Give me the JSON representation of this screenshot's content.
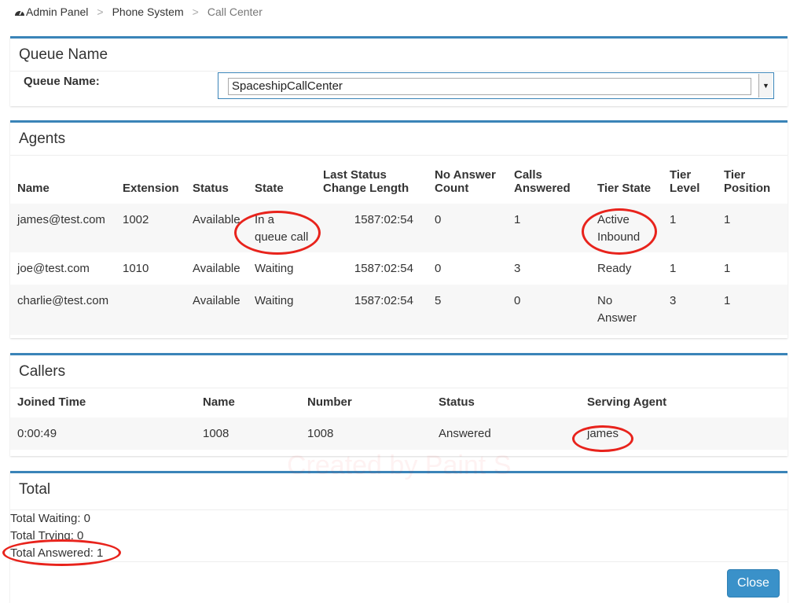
{
  "breadcrumb": {
    "items": [
      "Admin Panel",
      "Phone System",
      "Call Center"
    ]
  },
  "queue": {
    "heading": "Queue Name",
    "label": "Queue Name:",
    "selected": "SpaceshipCallCenter"
  },
  "agents": {
    "heading": "Agents",
    "columns": {
      "name": "Name",
      "extension": "Extension",
      "status": "Status",
      "state": "State",
      "last_status_1": "Last Status",
      "last_status_2": "Change Length",
      "no_answer_1": "No Answer",
      "no_answer_2": "Count",
      "calls_1": "Calls",
      "calls_2": "Answered",
      "tier_state": "Tier State",
      "tier_level_1": "Tier",
      "tier_level_2": "Level",
      "tier_position_1": "Tier",
      "tier_position_2": "Position"
    },
    "rows": [
      {
        "name": "james@test.com",
        "extension": "1002",
        "status": "Available",
        "state_1": "In a",
        "state_2": "queue call",
        "length": "1587:02:54",
        "no_answer": "0",
        "calls": "1",
        "tier_state_1": "Active",
        "tier_state_2": "Inbound",
        "tier_level": "1",
        "tier_position": "1"
      },
      {
        "name": "joe@test.com",
        "extension": "1010",
        "status": "Available",
        "state_1": "Waiting",
        "state_2": "",
        "length": "1587:02:54",
        "no_answer": "0",
        "calls": "3",
        "tier_state_1": "Ready",
        "tier_state_2": "",
        "tier_level": "1",
        "tier_position": "1"
      },
      {
        "name": "charlie@test.com",
        "extension": "",
        "status": "Available",
        "state_1": "Waiting",
        "state_2": "",
        "length": "1587:02:54",
        "no_answer": "5",
        "calls": "0",
        "tier_state_1": "No",
        "tier_state_2": "Answer",
        "tier_level": "3",
        "tier_position": "1"
      }
    ]
  },
  "callers": {
    "heading": "Callers",
    "columns": {
      "joined": "Joined Time",
      "name": "Name",
      "number": "Number",
      "status": "Status",
      "agent": "Serving Agent"
    },
    "rows": [
      {
        "joined": "0:00:49",
        "name": "1008",
        "number": "1008",
        "status": "Answered",
        "agent": "james"
      }
    ]
  },
  "total": {
    "heading": "Total",
    "waiting": "Total Waiting: 0",
    "trying": "Total Trying: 0",
    "answered": "Total Answered: 1"
  },
  "footer": {
    "close_label": "Close"
  },
  "watermark": "Created by Paint S",
  "colors": {
    "accent": "#3a84b8",
    "button": "#3a91c9",
    "annotation": "#e8231c"
  }
}
